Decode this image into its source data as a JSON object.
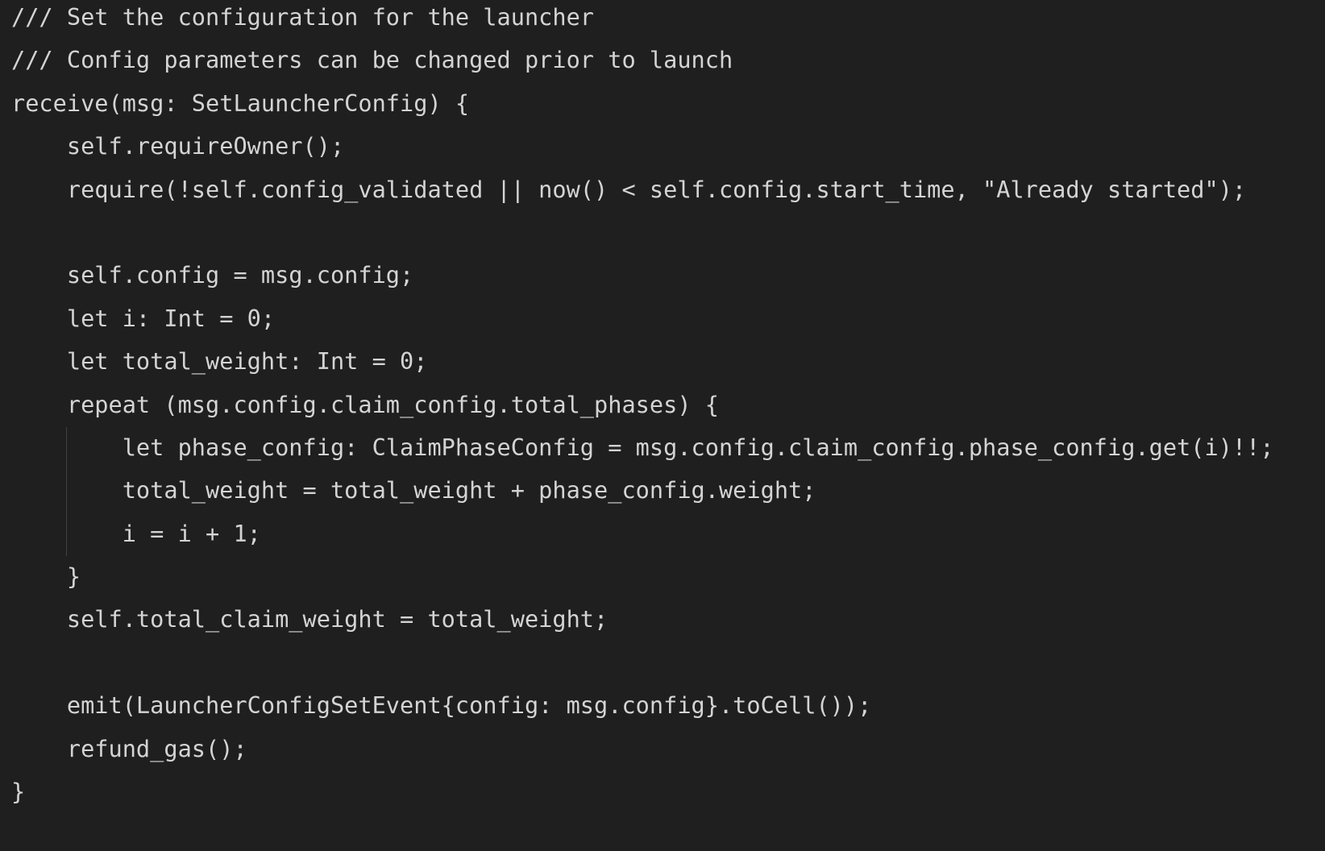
{
  "theme": {
    "background": "#1f1f1f",
    "text": "#d4d4d4",
    "indent_guide": "#404040"
  },
  "code": {
    "lines": [
      "/// Set the configuration for the launcher",
      "/// Config parameters can be changed prior to launch",
      "receive(msg: SetLauncherConfig) {",
      "    self.requireOwner();",
      "    require(!self.config_validated || now() < self.config.start_time, \"Already started\");",
      "",
      "    self.config = msg.config;",
      "    let i: Int = 0;",
      "    let total_weight: Int = 0;",
      "    repeat (msg.config.claim_config.total_phases) {",
      "        let phase_config: ClaimPhaseConfig = msg.config.claim_config.phase_config.get(i)!!;",
      "        total_weight = total_weight + phase_config.weight;",
      "        i = i + 1;",
      "    }",
      "    self.total_claim_weight = total_weight;",
      "",
      "    emit(LauncherConfigSetEvent{config: msg.config}.toCell());",
      "    refund_gas();",
      "}"
    ]
  }
}
